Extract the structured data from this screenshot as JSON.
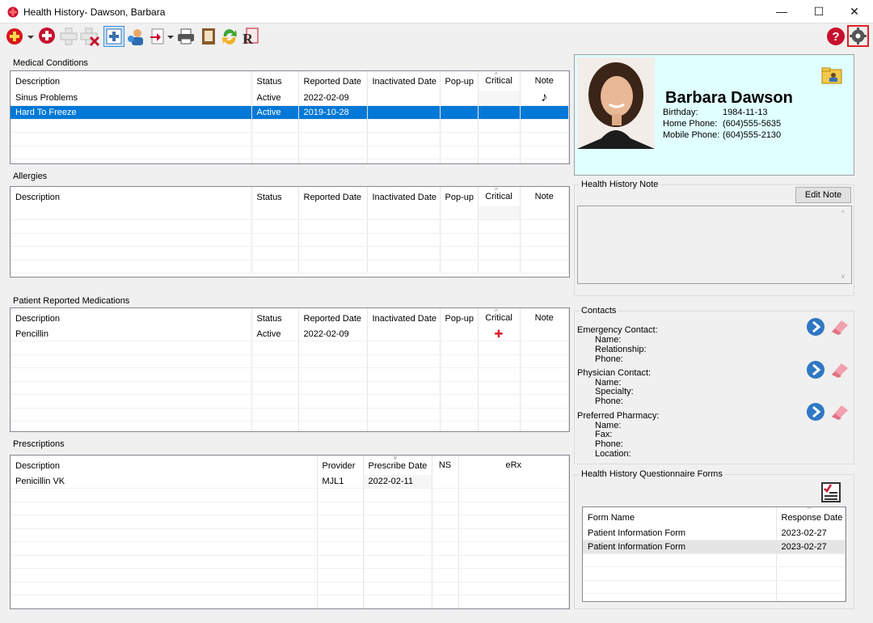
{
  "window": {
    "title": "Health History- Dawson, Barbara",
    "minimize": "—",
    "maximize": "☐",
    "close": "✕"
  },
  "toolbar": {
    "icons": [
      "add-condition-icon",
      "add-allergy-icon",
      "add-medication-icon",
      "delete-icon",
      "health-history-icon",
      "patient-icon",
      "import-icon",
      "print-icon",
      "report-icon",
      "refresh-icon",
      "prescription-icon"
    ],
    "help": "?",
    "settings": "⚙"
  },
  "medical_conditions": {
    "label": "Medical Conditions",
    "columns": [
      "Description",
      "Status",
      "Reported Date",
      "Inactivated Date",
      "Pop-up",
      "Critical",
      "Note"
    ],
    "rows": [
      [
        "Sinus Problems",
        "Active",
        "2022-02-09",
        "",
        "",
        "",
        "♪"
      ],
      [
        "Hard To Freeze",
        "Active",
        "2019-10-28",
        "",
        "",
        "",
        ""
      ]
    ]
  },
  "allergies": {
    "label": "Allergies",
    "columns": [
      "Description",
      "Status",
      "Reported Date",
      "Inactivated Date",
      "Pop-up",
      "Critical",
      "Note"
    ],
    "rows": []
  },
  "medications": {
    "label": "Patient Reported Medications",
    "columns": [
      "Description",
      "Status",
      "Reported Date",
      "Inactivated Date",
      "Pop-up",
      "Critical",
      "Note"
    ],
    "rows": [
      [
        "Pencillin",
        "Active",
        "2022-02-09",
        "",
        "",
        "✚",
        ""
      ]
    ]
  },
  "prescriptions": {
    "label": "Prescriptions",
    "columns": [
      "Description",
      "Provider",
      "Prescribe Date",
      "NS",
      "eRx"
    ],
    "rows": [
      [
        "Penicillin VK",
        "MJL1",
        "2022-02-11",
        "",
        ""
      ]
    ]
  },
  "patient": {
    "name": "Barbara Dawson",
    "birthday_label": "Birthday:",
    "birthday": "1984-11-13",
    "home_phone_label": "Home Phone:",
    "home_phone": "(604)555-5635",
    "mobile_phone_label": "Mobile Phone:",
    "mobile_phone": "(604)555-2130"
  },
  "health_note": {
    "label": "Health History Note",
    "edit_button": "Edit Note",
    "text": ""
  },
  "contacts": {
    "label": "Contacts",
    "emergency": {
      "title": "Emergency Contact:",
      "fields": [
        "Name:",
        "Relationship:",
        "Phone:"
      ]
    },
    "physician": {
      "title": "Physician Contact:",
      "fields": [
        "Name:",
        "Specialty:",
        "Phone:"
      ]
    },
    "pharmacy": {
      "title": "Preferred Pharmacy:",
      "fields": [
        "Name:",
        "Fax:",
        "Phone:",
        "Location:"
      ]
    }
  },
  "questionnaires": {
    "label": "Health History Questionnaire Forms",
    "columns": [
      "Form Name",
      "Response Date"
    ],
    "rows": [
      [
        "Patient Information Form",
        "2023-02-27"
      ],
      [
        "Patient Information Form",
        "2023-02-27"
      ]
    ]
  },
  "colors": {
    "selection": "#0078d7",
    "card": "#e0ffff",
    "critical": "#e0202a",
    "help": "#c8102e"
  }
}
